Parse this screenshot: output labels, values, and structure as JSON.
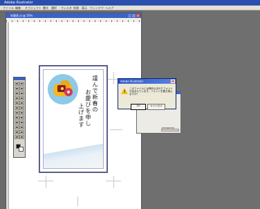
{
  "app": {
    "title": "Adobe Illustrator"
  },
  "menubar": {
    "items": [
      "ファイル",
      "編集",
      "オブジェクト",
      "書式",
      "選択",
      "フィルタ",
      "効果",
      "表示",
      "ウィンドウ",
      "ヘルプ"
    ]
  },
  "document": {
    "title": "年賀状.ai @ 50%"
  },
  "card": {
    "greeting_columns": [
      "謹んで新春の",
      "お慶びを申し",
      "上げます"
    ]
  },
  "dialog": {
    "title": "Adobe Illustrator",
    "message": "このファイルには埋め込まれたフォントが含まれています。フォントを置き換えますか？",
    "ok_label": "OK",
    "cancel_label": "キャンセル"
  },
  "colors": {
    "app_titlebar": "#2b4fb0",
    "workspace_gray": "#6f6f6f",
    "card_border": "#5a5f8a",
    "warning_yellow": "#f2c21a"
  },
  "icons": {
    "warning": "warning-triangle-icon",
    "close": "close-icon"
  }
}
